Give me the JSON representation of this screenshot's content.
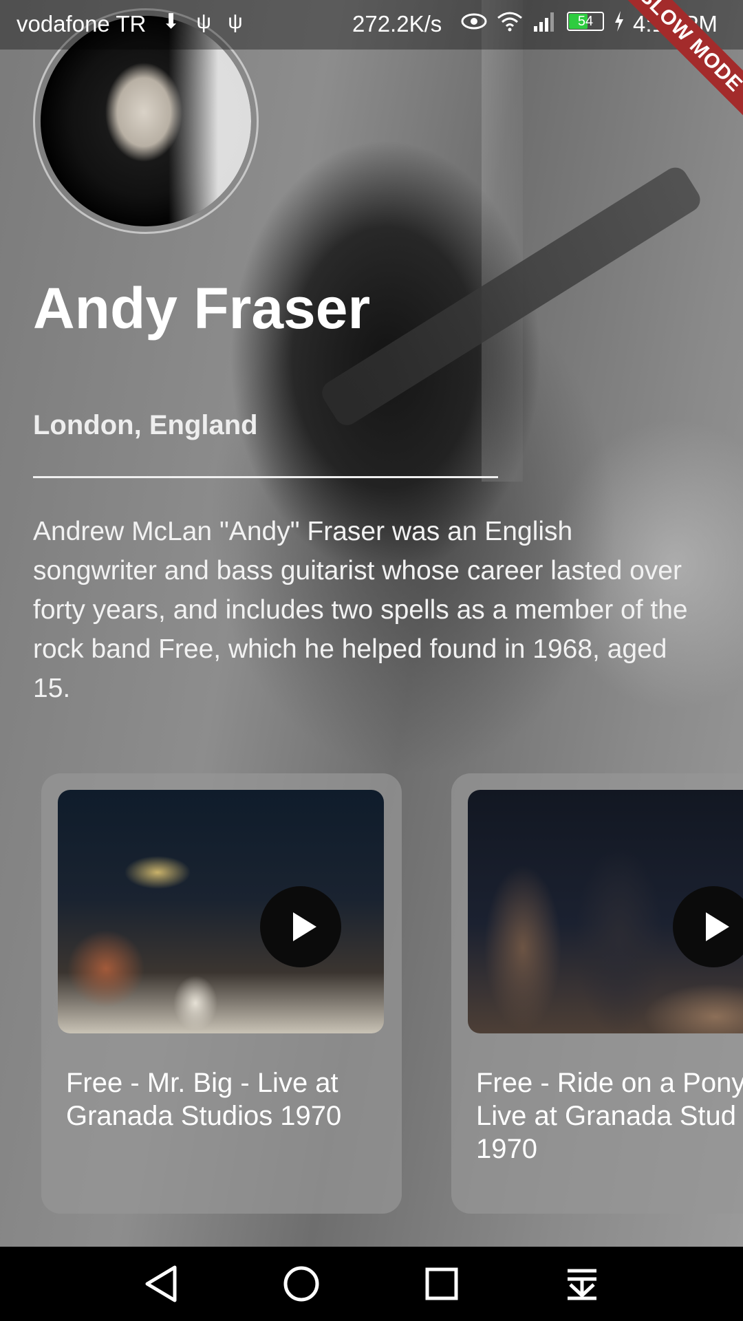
{
  "status_bar": {
    "carrier": "vodafone TR",
    "left_icons": "⬇ ψ ψ",
    "network_speed": "272.2K/s",
    "battery_level": "54",
    "battery_fill_pct": 54,
    "time": "4:17 PM"
  },
  "debug_banner": {
    "label": "SLOW MODE"
  },
  "profile": {
    "name": "Andy Fraser",
    "location": "London, England",
    "bio": "Andrew McLan \"Andy\" Fraser was an English songwriter and bass guitarist whose career lasted over forty years, and includes two spells as a member of the rock band Free, which he helped found in 1968, aged 15."
  },
  "videos": [
    {
      "title": "Free - Mr. Big - Live at Granada Studios 1970"
    },
    {
      "title_lines": [
        "Free - Ride on a Pony",
        "Live at Granada Stud",
        "1970"
      ]
    }
  ],
  "nav": {
    "icons": [
      "back-icon",
      "home-icon",
      "recents-icon",
      "notifications-down-icon"
    ]
  }
}
